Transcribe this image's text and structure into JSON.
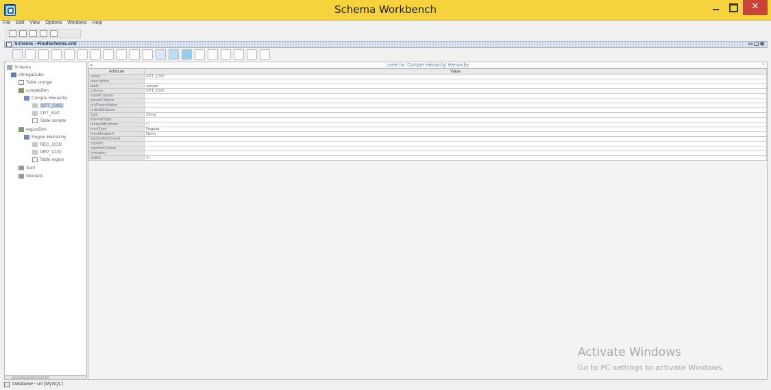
{
  "window": {
    "title": "Schema Workbench"
  },
  "menu": [
    "File",
    "Edit",
    "View",
    "Options",
    "Windows",
    "Help"
  ],
  "frame": {
    "title": "Schema - FinalSchema.xml"
  },
  "tree": [
    {
      "label": "Schema",
      "icon": "schema-icon"
    },
    {
      "label": "OmegaCube",
      "icon": "cube-icon"
    },
    {
      "label": "Table orange",
      "icon": "table-icon"
    },
    {
      "label": "compteDim",
      "icon": "dimension-icon"
    },
    {
      "label": "Compte Hierarchy",
      "icon": "hierarchy-icon"
    },
    {
      "label": "CPT_COD",
      "icon": "level-icon",
      "selected": true
    },
    {
      "label": "CPT_NAT",
      "icon": "level-icon"
    },
    {
      "label": "Table compte",
      "icon": "table-icon"
    },
    {
      "label": "regionDim",
      "icon": "dimension-icon"
    },
    {
      "label": "Region Hierarchy",
      "icon": "hierarchy-icon"
    },
    {
      "label": "REG_COD",
      "icon": "level-icon"
    },
    {
      "label": "DRP_COD",
      "icon": "level-icon"
    },
    {
      "label": "Table region",
      "icon": "table-icon"
    },
    {
      "label": "Sum",
      "icon": "measure-icon"
    },
    {
      "label": "Montant",
      "icon": "measure-icon"
    }
  ],
  "panel": {
    "title": "Level for 'Compte Hierarchy' Hierarchy",
    "columns": [
      "Attribute",
      "Value"
    ],
    "rows": [
      {
        "attr": "name",
        "value": "CPT_COD"
      },
      {
        "attr": "description",
        "value": ""
      },
      {
        "attr": "table",
        "value": "compte"
      },
      {
        "attr": "column",
        "value": "CPT_COD"
      },
      {
        "attr": "nameColumn",
        "value": ""
      },
      {
        "attr": "parentColumn",
        "value": ""
      },
      {
        "attr": "nullParentValue",
        "value": ""
      },
      {
        "attr": "ordinalColumn",
        "value": ""
      },
      {
        "attr": "type",
        "value": "String"
      },
      {
        "attr": "internalType",
        "value": ""
      },
      {
        "attr": "uniqueMembers",
        "value": "☐"
      },
      {
        "attr": "levelType",
        "value": "Regular"
      },
      {
        "attr": "hideMemberIf",
        "value": "Never"
      },
      {
        "attr": "approxRowCount",
        "value": ""
      },
      {
        "attr": "caption",
        "value": ""
      },
      {
        "attr": "captionColumn",
        "value": ""
      },
      {
        "attr": "formatter",
        "value": ""
      },
      {
        "attr": "visible",
        "value": "☑"
      }
    ]
  },
  "watermark": {
    "title": "Activate Windows",
    "subtitle": "Go to PC settings to activate Windows."
  },
  "status": {
    "text": "Database - url (MySQL)"
  },
  "colors": {
    "titlebar": "#f6d23c",
    "close": "#c94338",
    "selection": "#c6d7ea"
  }
}
